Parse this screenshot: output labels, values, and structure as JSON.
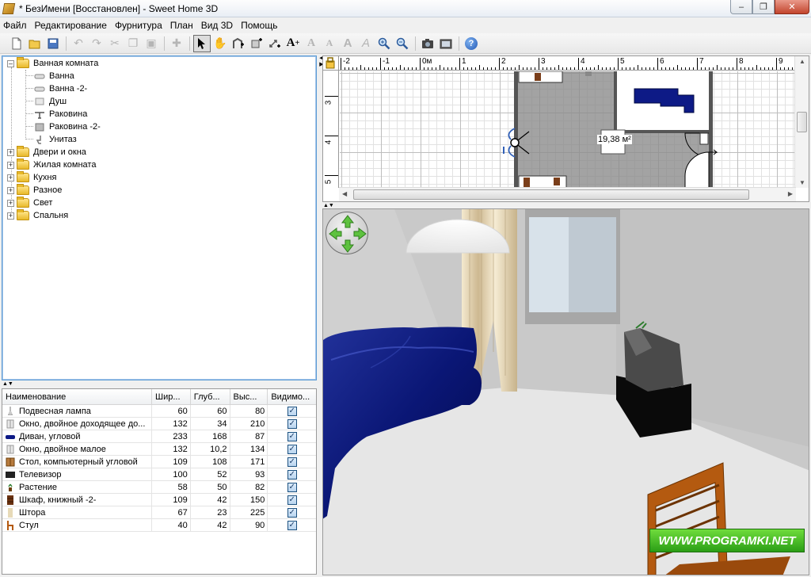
{
  "window": {
    "title": "* БезИмени [Восстановлен] - Sweet Home 3D"
  },
  "menu": [
    "Файл",
    "Редактирование",
    "Фурнитура",
    "План",
    "Вид 3D",
    "Помощь"
  ],
  "toolbar": {
    "icons": [
      "new-file-icon",
      "open-file-icon",
      "save-icon",
      "undo-icon",
      "redo-icon",
      "cut-icon",
      "copy-icon",
      "paste-icon",
      "add-furniture-icon",
      "select-arrow-icon",
      "pan-hand-icon",
      "create-walls-icon",
      "create-rooms-icon",
      "create-dimensions-icon",
      "add-text-icon",
      "modify-text-style-icon",
      "bold-text-icon",
      "italic-text-icon",
      "italic-a-icon",
      "zoom-in-icon",
      "zoom-out-icon",
      "create-photo-icon",
      "create-video-icon",
      "help-icon"
    ]
  },
  "catalog": {
    "categories": [
      {
        "label": "Ванная комната",
        "expanded": true,
        "items": [
          "Ванна",
          "Ванна -2-",
          "Душ",
          "Раковина",
          "Раковина -2-",
          "Унитаз"
        ]
      },
      {
        "label": "Двери и окна",
        "expanded": false
      },
      {
        "label": "Жилая комната",
        "expanded": false
      },
      {
        "label": "Кухня",
        "expanded": false
      },
      {
        "label": "Разное",
        "expanded": false
      },
      {
        "label": "Свет",
        "expanded": false
      },
      {
        "label": "Спальня",
        "expanded": false
      }
    ]
  },
  "furniture_table": {
    "headers": [
      "Наименование",
      "Шир...",
      "Глуб...",
      "Выс...",
      "Видимо..."
    ],
    "rows": [
      {
        "name": "Подвесная лампа",
        "width": "60",
        "depth": "60",
        "height": "80",
        "visible": true,
        "icon": "lamp-icon"
      },
      {
        "name": "Окно, двойное доходящее до...",
        "width": "132",
        "depth": "34",
        "height": "210",
        "visible": true,
        "icon": "window-icon"
      },
      {
        "name": "Диван, угловой",
        "width": "233",
        "depth": "168",
        "height": "87",
        "visible": true,
        "icon": "sofa-icon"
      },
      {
        "name": "Окно, двойное малое",
        "width": "132",
        "depth": "10,2",
        "height": "134",
        "visible": true,
        "icon": "window-icon"
      },
      {
        "name": "Стол, компьютерный угловой",
        "width": "109",
        "depth": "108",
        "height": "171",
        "visible": true,
        "icon": "desk-icon"
      },
      {
        "name": "Телевизор",
        "width": "100",
        "depth": "52",
        "height": "93",
        "visible": true,
        "icon": "tv-icon"
      },
      {
        "name": "Растение",
        "width": "58",
        "depth": "50",
        "height": "82",
        "visible": true,
        "icon": "plant-icon"
      },
      {
        "name": "Шкаф, книжный -2-",
        "width": "109",
        "depth": "42",
        "height": "150",
        "visible": true,
        "icon": "bookcase-icon"
      },
      {
        "name": "Штора",
        "width": "67",
        "depth": "23",
        "height": "225",
        "visible": true,
        "icon": "curtain-icon"
      },
      {
        "name": "Стул",
        "width": "40",
        "depth": "42",
        "height": "90",
        "visible": true,
        "icon": "chair-icon"
      }
    ]
  },
  "plan": {
    "ruler_top": [
      "-2",
      "-1",
      "0м",
      "1",
      "2",
      "3",
      "4",
      "5",
      "6",
      "7",
      "8",
      "9"
    ],
    "ruler_left": [
      "3",
      "4",
      "5"
    ],
    "room_area": "19,38 м²"
  },
  "view3d": {
    "watermark": "WWW.PROGRAMKI.NET"
  },
  "colors": {
    "sofa": "#0a1a7a",
    "floor": "#e6e6e6",
    "wall": "#c4c4c4",
    "chair": "#b45a10",
    "watermark_green": "#3cb521"
  }
}
